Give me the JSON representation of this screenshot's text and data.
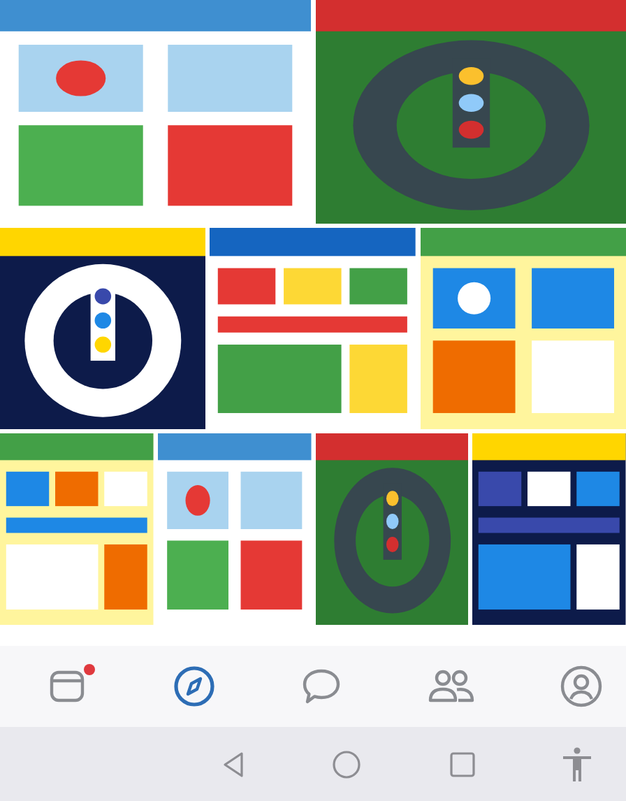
{
  "tab_bar": {
    "items": [
      {
        "kind": "feed",
        "selected": false,
        "badge": true
      },
      {
        "kind": "discover",
        "selected": true,
        "badge": false
      },
      {
        "kind": "messages",
        "selected": false,
        "badge": false
      },
      {
        "kind": "friends",
        "selected": false,
        "badge": false
      },
      {
        "kind": "profile",
        "selected": false,
        "badge": false
      }
    ]
  },
  "system_nav": {
    "items": [
      {
        "kind": "back"
      },
      {
        "kind": "home"
      },
      {
        "kind": "recents"
      },
      {
        "kind": "accessibility"
      }
    ]
  }
}
